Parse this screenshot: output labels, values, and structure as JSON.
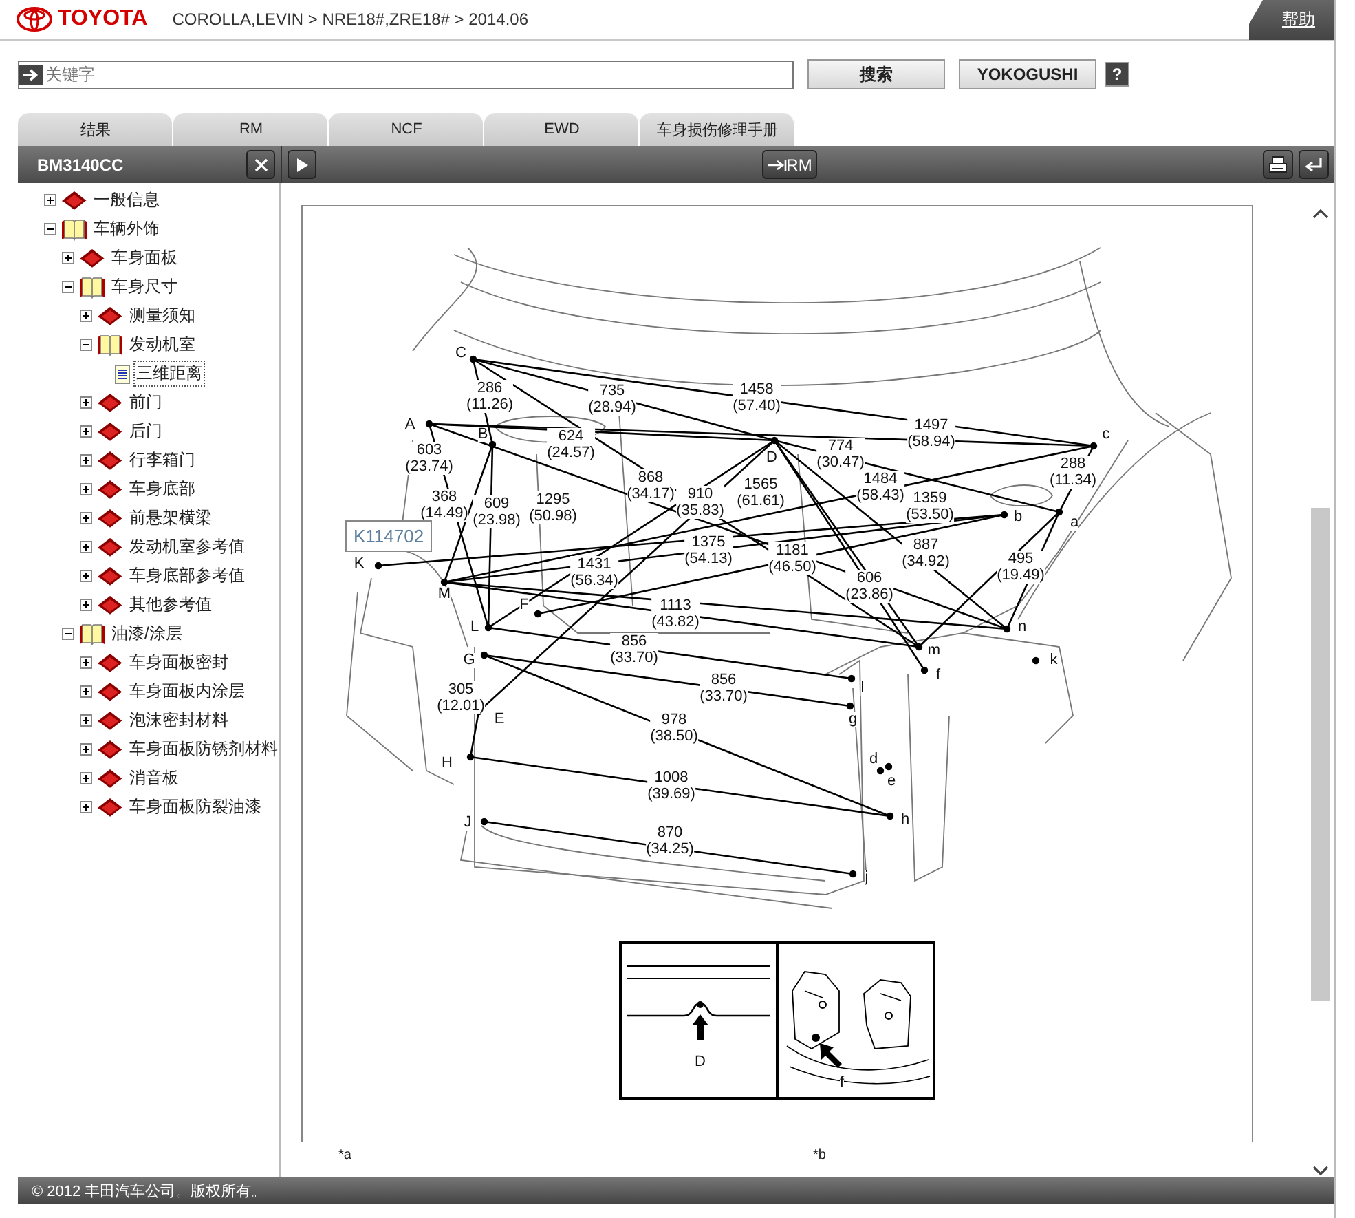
{
  "header": {
    "brand": "TOYOTA",
    "breadcrumb": "COROLLA,LEVIN > NRE18#,ZRE18# > 2014.06",
    "help": "帮助"
  },
  "search": {
    "placeholder": "关键字",
    "buttons": [
      "搜索",
      "YOKOGUSHI"
    ],
    "help_icon": "?"
  },
  "tabs": [
    {
      "label": "结果"
    },
    {
      "label": "RM"
    },
    {
      "label": "NCF"
    },
    {
      "label": "EWD"
    },
    {
      "label": "车身损伤修理手册"
    }
  ],
  "toolbar": {
    "doc_code": "BM3140CC",
    "rm_button": "RM"
  },
  "sidebar": {
    "items": [
      {
        "label": "一般信息",
        "kind": "book",
        "expanded": false,
        "selected": false
      },
      {
        "label": "车辆外饰",
        "kind": "book",
        "expanded": true,
        "selected": false,
        "children": [
          {
            "label": "车身面板",
            "kind": "book",
            "expanded": false,
            "selected": false
          },
          {
            "label": "车身尺寸",
            "kind": "book",
            "expanded": true,
            "selected": false,
            "children": [
              {
                "label": "测量须知",
                "kind": "book",
                "expanded": false,
                "selected": false
              },
              {
                "label": "发动机室",
                "kind": "book",
                "expanded": true,
                "selected": false,
                "children": [
                  {
                    "label": "三维距离",
                    "kind": "page",
                    "selected": true
                  }
                ]
              },
              {
                "label": "前门",
                "kind": "book",
                "expanded": false,
                "selected": false
              },
              {
                "label": "后门",
                "kind": "book",
                "expanded": false,
                "selected": false
              },
              {
                "label": "行李箱门",
                "kind": "book",
                "expanded": false,
                "selected": false
              },
              {
                "label": "车身底部",
                "kind": "book",
                "expanded": false,
                "selected": false
              },
              {
                "label": "前悬架横梁",
                "kind": "book",
                "expanded": false,
                "selected": false
              },
              {
                "label": "发动机室参考值",
                "kind": "book",
                "expanded": false,
                "selected": false
              },
              {
                "label": "车身底部参考值",
                "kind": "book",
                "expanded": false,
                "selected": false
              },
              {
                "label": "其他参考值",
                "kind": "book",
                "expanded": false,
                "selected": false
              }
            ]
          },
          {
            "label": "油漆/涂层",
            "kind": "book",
            "expanded": true,
            "selected": false,
            "children": [
              {
                "label": "车身面板密封",
                "kind": "book",
                "expanded": false,
                "selected": false
              },
              {
                "label": "车身面板内涂层",
                "kind": "book",
                "expanded": false,
                "selected": false
              },
              {
                "label": "泡沫密封材料",
                "kind": "book",
                "expanded": false,
                "selected": false
              },
              {
                "label": "车身面板防锈剂材料",
                "kind": "book",
                "expanded": false,
                "selected": false
              },
              {
                "label": "消音板",
                "kind": "book",
                "expanded": false,
                "selected": false
              },
              {
                "label": "车身面板防裂油漆",
                "kind": "book",
                "expanded": false,
                "selected": false
              }
            ]
          }
        ]
      }
    ]
  },
  "diagram": {
    "id_tag": "K114702",
    "points": [
      {
        "label": "A"
      },
      {
        "label": "B"
      },
      {
        "label": "C"
      },
      {
        "label": "D"
      },
      {
        "label": "E"
      },
      {
        "label": "F"
      },
      {
        "label": "G"
      },
      {
        "label": "H"
      },
      {
        "label": "J"
      },
      {
        "label": "K"
      },
      {
        "label": "L"
      },
      {
        "label": "M"
      },
      {
        "label": "a"
      },
      {
        "label": "b"
      },
      {
        "label": "c"
      },
      {
        "label": "d"
      },
      {
        "label": "e"
      },
      {
        "label": "f"
      },
      {
        "label": "g"
      },
      {
        "label": "h"
      },
      {
        "label": "j"
      },
      {
        "label": "k"
      },
      {
        "label": "l"
      },
      {
        "label": "m"
      },
      {
        "label": "n"
      }
    ],
    "measurements": [
      {
        "primary": "286",
        "secondary": "(11.26)"
      },
      {
        "primary": "735",
        "secondary": "(28.94)"
      },
      {
        "primary": "1458",
        "secondary": "(57.40)"
      },
      {
        "primary": "603",
        "secondary": "(23.74)"
      },
      {
        "primary": "624",
        "secondary": "(24.57)"
      },
      {
        "primary": "774",
        "secondary": "(30.47)"
      },
      {
        "primary": "1497",
        "secondary": "(58.94)"
      },
      {
        "primary": "288",
        "secondary": "(11.34)"
      },
      {
        "primary": "368",
        "secondary": "(14.49)"
      },
      {
        "primary": "609",
        "secondary": "(23.98)"
      },
      {
        "primary": "1295",
        "secondary": "(50.98)"
      },
      {
        "primary": "868",
        "secondary": "(34.17)"
      },
      {
        "primary": "910",
        "secondary": "(35.83)"
      },
      {
        "primary": "1565",
        "secondary": "(61.61)"
      },
      {
        "primary": "1484",
        "secondary": "(58.43)"
      },
      {
        "primary": "1359",
        "secondary": "(53.50)"
      },
      {
        "primary": "1431",
        "secondary": "(56.34)"
      },
      {
        "primary": "1375",
        "secondary": "(54.13)"
      },
      {
        "primary": "1181",
        "secondary": "(46.50)"
      },
      {
        "primary": "606",
        "secondary": "(23.86)"
      },
      {
        "primary": "887",
        "secondary": "(34.92)"
      },
      {
        "primary": "495",
        "secondary": "(19.49)"
      },
      {
        "primary": "1113",
        "secondary": "(43.82)"
      },
      {
        "primary": "856",
        "secondary": "(33.70)"
      },
      {
        "primary": "856",
        "secondary": "(33.70)"
      },
      {
        "primary": "305",
        "secondary": "(12.01)"
      },
      {
        "primary": "978",
        "secondary": "(38.50)"
      },
      {
        "primary": "1008",
        "secondary": "(39.69)"
      },
      {
        "primary": "870",
        "secondary": "(34.25)"
      }
    ],
    "inset_labels": [
      "D",
      "f"
    ],
    "notes": [
      "*a",
      "*b"
    ]
  },
  "footer": "© 2012 丰田汽车公司。版权所有。"
}
